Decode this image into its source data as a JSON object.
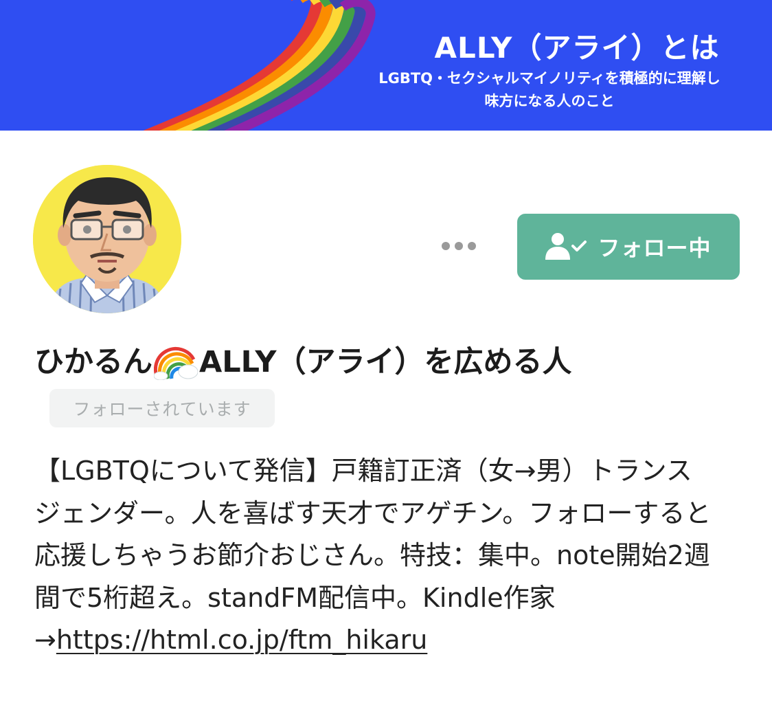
{
  "banner": {
    "title": "ALLY（アライ）とは",
    "subtitle_line1": "LGBTQ・セクシャルマイノリティを積極的に理解し",
    "subtitle_line2": "味方になる人のこと",
    "background_color": "#2f4ef2",
    "decoration_icon": "rainbow-ribbon-icon"
  },
  "profile": {
    "avatar_icon": "cartoon-man-with-glasses-avatar",
    "display_name_prefix": "ひかるん",
    "display_name_emoji": "rainbow-emoji",
    "display_name_suffix": "ALLY（アライ）を広める人",
    "follows_you_label": "フォローされています",
    "bio_lines": [
      " 【LGBTQについて発信】戸籍訂正済（女→男）トランス",
      "ジェンダー。人を喜ばす天才でアゲチン。フォローすると",
      "応援しちゃうお節介おじさん。特技：集中。note開始2週",
      "間で5桁超え。standFM配信中。Kindle作家"
    ],
    "link_prefix": "→",
    "link_text": "https://html.co.jp/ftm_hikaru"
  },
  "actions": {
    "more_icon": "more-horizontal-icon",
    "follow_icon": "user-check-icon",
    "follow_label": "フォロー中",
    "follow_color": "#5fb49a"
  }
}
